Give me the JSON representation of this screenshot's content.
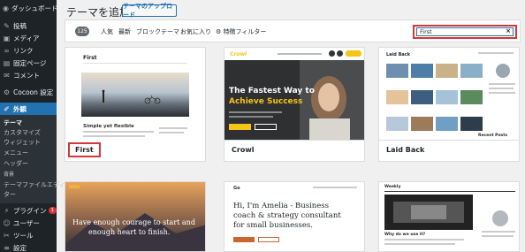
{
  "sidebar": {
    "items": [
      {
        "label": "ダッシュボード",
        "icon": "dashboard-icon"
      },
      {
        "label": "投稿",
        "icon": "pin-icon"
      },
      {
        "label": "メディア",
        "icon": "media-icon"
      },
      {
        "label": "リンク",
        "icon": "link-icon"
      },
      {
        "label": "固定ページ",
        "icon": "page-icon"
      },
      {
        "label": "コメント",
        "icon": "comment-icon"
      },
      {
        "label": "Cocoon 設定",
        "icon": "gear-icon"
      },
      {
        "label": "外観",
        "icon": "brush-icon"
      }
    ],
    "appearance_sub": [
      "テーマ",
      "カスタマイズ",
      "ウィジェット",
      "メニュー",
      "ヘッダー",
      "背景",
      "テーマファイルエディ",
      "ター"
    ],
    "bottom_items": [
      {
        "label": "プラグイン",
        "icon": "plugin-icon",
        "badge": "1"
      },
      {
        "label": "ユーザー",
        "icon": "user-icon"
      },
      {
        "label": "ツール",
        "icon": "tool-icon"
      },
      {
        "label": "設定",
        "icon": "settings-icon"
      }
    ]
  },
  "header": {
    "title": "テーマを追加",
    "upload_label": "テーマのアップロード"
  },
  "filter": {
    "count": "125",
    "tabs": [
      "人気",
      "最新",
      "ブロックテーマ",
      "お気に入り",
      "特徴フィルター"
    ],
    "search_value": "First",
    "clear_label": "×"
  },
  "themes": [
    {
      "name": "First"
    },
    {
      "name": "Crowl"
    },
    {
      "name": "Laid Back"
    },
    {
      "name": ""
    },
    {
      "name": ""
    },
    {
      "name": ""
    }
  ],
  "previews": {
    "first": {
      "site_title": "First",
      "post_title": "Simple yet flexible"
    },
    "crowl": {
      "logo": "Crowl",
      "headline_1": "The Fastest Way to",
      "headline_2": "Achieve Success"
    },
    "laidback": {
      "site_title": "Laid Back",
      "sidebar_title": "Recent Posts"
    },
    "bold": {
      "line1": "Have enough courage to start and",
      "line2": "enough heart to finish."
    },
    "amelia": {
      "logo": "Go",
      "line1": "Hi, I'm Amelia - Business",
      "line2": "coach & strategy consultant",
      "line3": "for small businesses."
    },
    "weekly": {
      "logo": "Weekly",
      "post_title": "Why do we use it?"
    }
  },
  "colors": {
    "accent": "#2271b1",
    "highlight": "#d63638",
    "sidebar": "#1d2327",
    "crowl_yellow": "#f5c518"
  }
}
